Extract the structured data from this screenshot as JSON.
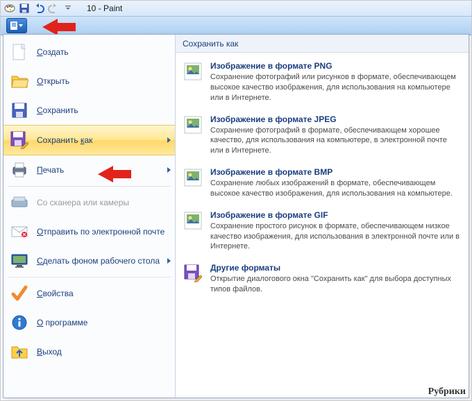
{
  "titlebar": {
    "title": "10 - Paint"
  },
  "menu": {
    "items": [
      {
        "key": "new",
        "label": "Создать",
        "icon": "new-doc"
      },
      {
        "key": "open",
        "label": "Открыть",
        "icon": "folder-open"
      },
      {
        "key": "save",
        "label": "Сохранить",
        "icon": "disk"
      },
      {
        "key": "saveas",
        "label": "Сохранить как",
        "icon": "disk-pencil",
        "submenu": true,
        "selected": true
      },
      {
        "key": "print",
        "label": "Печать",
        "icon": "printer",
        "submenu": true
      },
      {
        "key": "scan",
        "label": "Со сканера или камеры",
        "icon": "scanner",
        "disabled": true
      },
      {
        "key": "send",
        "label": "Отправить по электронной почте",
        "icon": "mail"
      },
      {
        "key": "wall",
        "label": "Сделать фоном рабочего стола",
        "icon": "desktop",
        "submenu": true
      },
      {
        "key": "props",
        "label": "Свойства",
        "icon": "check"
      },
      {
        "key": "about",
        "label": "О программе",
        "icon": "info"
      },
      {
        "key": "exit",
        "label": "Выход",
        "icon": "folder-up"
      }
    ]
  },
  "panel": {
    "title": "Сохранить как",
    "formats": [
      {
        "key": "png",
        "title": "Изображение в формате PNG",
        "desc": "Сохранение фотографий или рисунков в формате, обеспечивающем высокое качество изображения, для использования на компьютере или в Интернете."
      },
      {
        "key": "jpeg",
        "title": "Изображение в формате JPEG",
        "desc": "Сохранение фотографий в формате, обеспечивающем хорошее качество, для использования на компьютере, в электронной почте или в Интернете."
      },
      {
        "key": "bmp",
        "title": "Изображение в формате BMP",
        "desc": "Сохранение любых изображений в формате, обеспечивающем высокое качество изображения, для использования на компьютере."
      },
      {
        "key": "gif",
        "title": "Изображение в формате GIF",
        "desc": "Сохранение простого рисунок в формате, обеспечивающем низкое качество изображения, для использования в электронной почте или в Интернете."
      },
      {
        "key": "other",
        "title": "Другие форматы",
        "desc": "Открытие диалогового окна \"Сохранить как\" для выбора доступных типов файлов."
      }
    ]
  },
  "footer": {
    "label": "Рубрики"
  }
}
